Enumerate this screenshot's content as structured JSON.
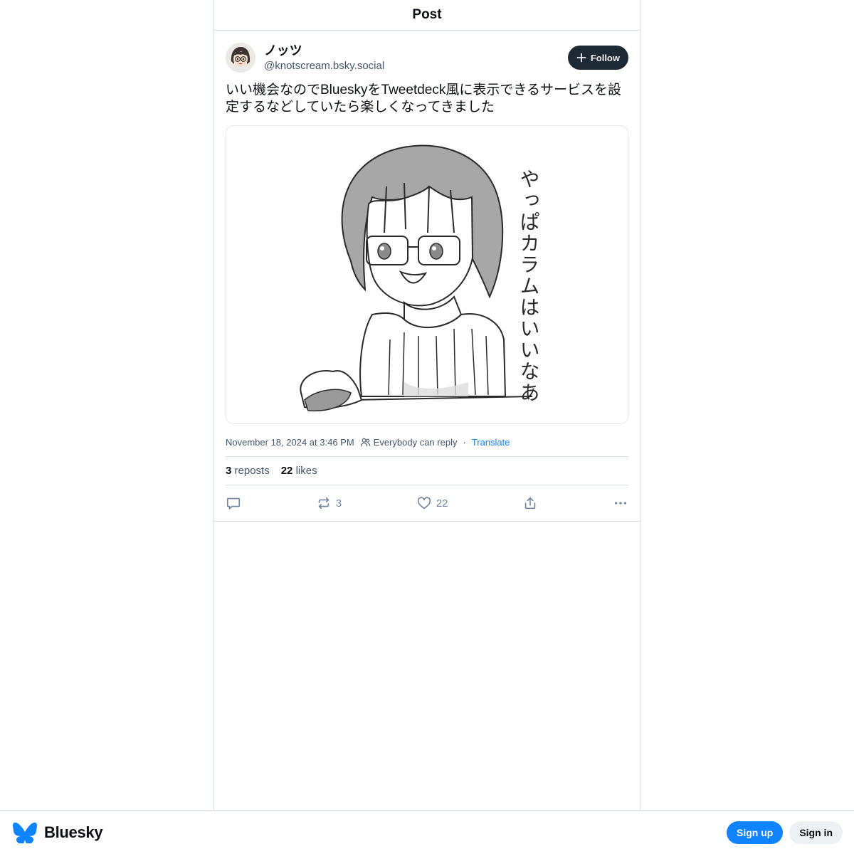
{
  "header": {
    "title": "Post"
  },
  "post": {
    "author": {
      "display_name": "ノッツ",
      "handle": "@knotscream.bsky.social",
      "avatar_icon": "avatar-illustration"
    },
    "follow_label": "Follow",
    "text": "いい機会なのでBlueskyをTweetdeck風に表示できるサービスを設定するなどしていたら楽しくなってきました",
    "image": {
      "handwritten_text": "やっぱカラムはいいなあ",
      "description_icon": "drawing-of-girl-with-glasses"
    },
    "timestamp": "November 18, 2024 at 3:46 PM",
    "reply_setting": "Everybody can reply",
    "separator": "·",
    "translate_label": "Translate",
    "stats": {
      "reposts_count": "3",
      "reposts_label": "reposts",
      "likes_count": "22",
      "likes_label": "likes"
    },
    "actions": {
      "reply_icon": "comment-icon",
      "repost_count": "3",
      "like_count": "22",
      "share_icon": "share-icon",
      "more_icon": "more-icon"
    }
  },
  "bottom_bar": {
    "brand": "Bluesky",
    "signup_label": "Sign up",
    "signin_label": "Sign in"
  },
  "colors": {
    "accent": "#1083fe",
    "follow_bg": "#1e2936",
    "muted_text": "#42576c",
    "border": "#d4dbe2"
  }
}
